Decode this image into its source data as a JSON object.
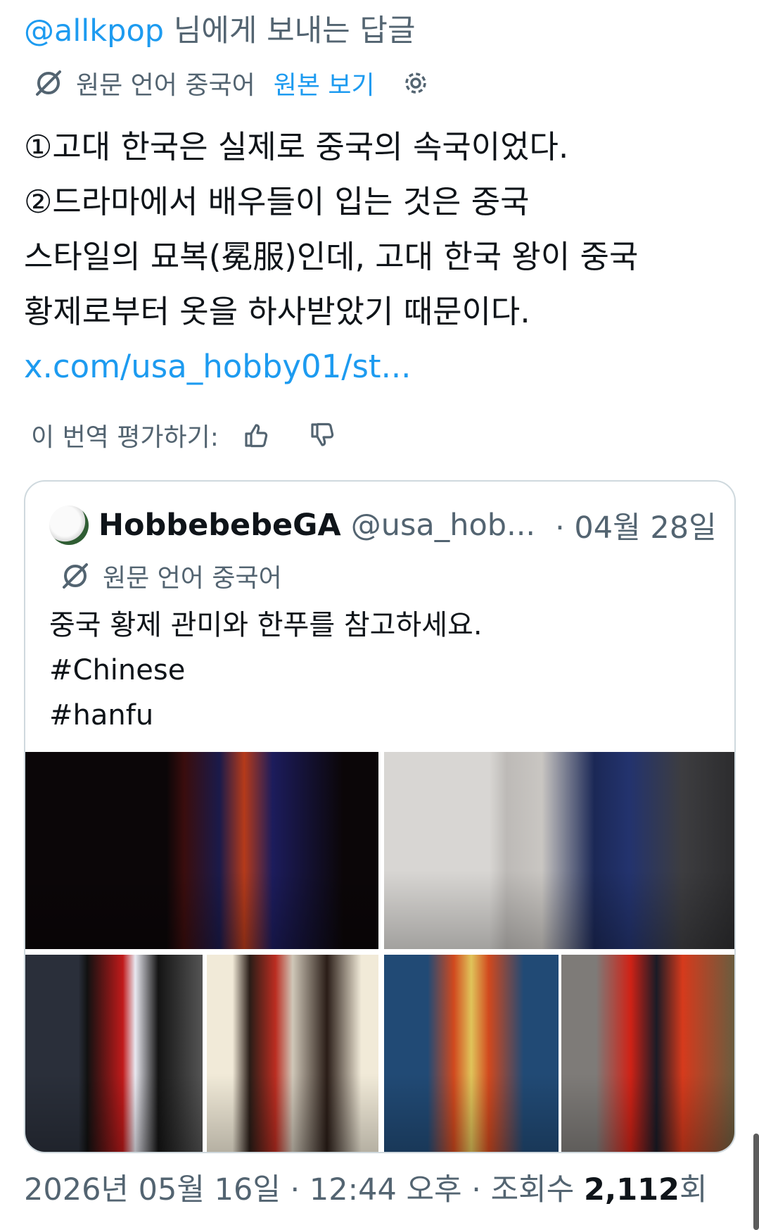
{
  "reply": {
    "handle": "@allkpop",
    "suffix": " 님에게 보내는 답글"
  },
  "translation": {
    "icon": "translate-off-icon",
    "source_label": "원문 언어 중국어",
    "show_original": "원본 보기",
    "settings_icon": "gear-icon"
  },
  "tweet": {
    "lines": [
      "①고대 한국은 실제로 중국의 속국이었다.",
      "②드라마에서 배우들이 입는 것은 중국",
      "스타일의 묘복(冕服)인데, 고대 한국 왕이 중국",
      "황제로부터 옷을 하사받았기 때문이다."
    ],
    "link": "x.com/usa_hobby01/st..."
  },
  "rate": {
    "label": "이 번역 평가하기:",
    "up_icon": "thumbs-up-icon",
    "down_icon": "thumbs-down-icon"
  },
  "quote": {
    "name": "HobbebebeGA",
    "handle": "@usa_hob...",
    "date": "· 04월 28일",
    "translation_label": "원문 언어 중국어",
    "lines": [
      "중국 황제 관미와 한푸를 참고하세요.",
      "#Chinese",
      "#hanfu"
    ],
    "media": [
      "photo-1",
      "photo-2",
      "photo-3",
      "photo-4",
      "photo-5",
      "photo-6"
    ]
  },
  "meta": {
    "timestamp": "2026년 05월 16일 · 12:44 오후 · 조회수 ",
    "views": "2,112",
    "views_suffix": "회"
  },
  "colors": {
    "link": "#1d9bf0",
    "secondary_text": "#536471",
    "text": "#0f1419",
    "border": "#cfd9de"
  }
}
